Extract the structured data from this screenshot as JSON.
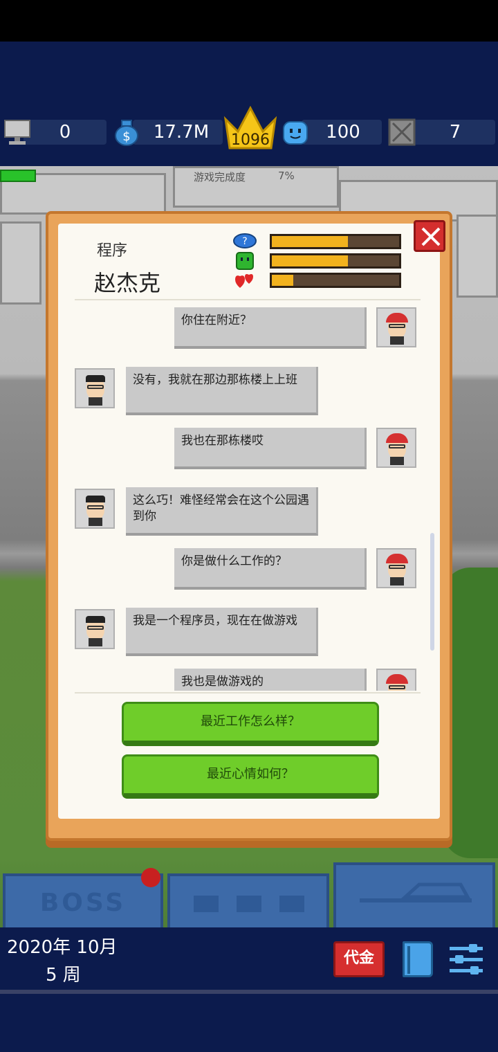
{
  "stats": {
    "computers": "0",
    "money": "17.7M",
    "crown_rank": "1096",
    "fans": "100",
    "bugs": "7"
  },
  "progress": {
    "label": "游戏完成度",
    "percent_text": "7%",
    "fraction": 0.07
  },
  "dialog": {
    "role": "程序",
    "name": "赵杰克",
    "meters": [
      {
        "icon": "question-bubble-icon",
        "fraction": 0.6
      },
      {
        "icon": "green-slime-icon",
        "fraction": 0.6
      },
      {
        "icon": "hearts-icon",
        "fraction": 0.17
      }
    ],
    "messages": [
      {
        "side": "right",
        "text": "你住在附近？"
      },
      {
        "side": "left",
        "text": "没有，我就在那边那栋楼上上班"
      },
      {
        "side": "right",
        "text": "我也在那栋楼哎"
      },
      {
        "side": "left",
        "text": "这么巧！难怪经常会在这个公园遇到你"
      },
      {
        "side": "right",
        "text": "你是做什么工作的？"
      },
      {
        "side": "left",
        "text": "我是一个程序员，现在在做游戏"
      },
      {
        "side": "right",
        "text": "我也是做游戏的"
      }
    ],
    "choices": [
      "最近工作怎么样？",
      "最近心情如何？"
    ]
  },
  "tabs": [
    "BOSS",
    "",
    ""
  ],
  "date": {
    "line1": "2020年 10月",
    "line2": "5 周"
  },
  "buttons": {
    "cash_label": "代金"
  },
  "colors": {
    "navy": "#0c1b4d",
    "green_button": "#6fcd2a",
    "meter_fill": "#f2b21e",
    "close_red": "#d42e2e"
  }
}
